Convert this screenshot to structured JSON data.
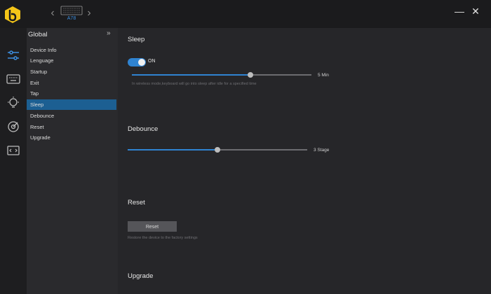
{
  "titlebar": {
    "device_name": "A78",
    "minimize_label": "—",
    "close_label": "✕",
    "back_label": "‹",
    "forward_label": "›"
  },
  "sidebar_icons": [
    {
      "name": "settings-sliders-icon",
      "active": true
    },
    {
      "name": "keyboard-icon",
      "active": false
    },
    {
      "name": "lighting-icon",
      "active": false
    },
    {
      "name": "macro-target-icon",
      "active": false
    },
    {
      "name": "code-icon",
      "active": false
    }
  ],
  "submenu": {
    "title": "Global",
    "collapse_label": "»",
    "items": [
      {
        "label": "Device Info",
        "active": false
      },
      {
        "label": "Lenguage",
        "active": false
      },
      {
        "label": "Startup",
        "active": false
      },
      {
        "label": "Exit",
        "active": false
      },
      {
        "label": "Tap",
        "active": false
      },
      {
        "label": "Sleep",
        "active": true
      },
      {
        "label": "Debounce",
        "active": false
      },
      {
        "label": "Reset",
        "active": false
      },
      {
        "label": "Upgrade",
        "active": false
      }
    ]
  },
  "sleep": {
    "title": "Sleep",
    "toggle_label": "ON",
    "slider_value_label": "5 Min",
    "slider_fraction": 0.66,
    "hint": "In wireless mode,keyboard will go into sleep after idle for a specified time"
  },
  "debounce": {
    "title": "Debounce",
    "slider_value_label": "3 Stage",
    "slider_fraction": 0.5
  },
  "reset": {
    "title": "Reset",
    "button_label": "Reset",
    "hint": "Restore the device to the factory settings"
  },
  "upgrade": {
    "title": "Upgrade"
  },
  "colors": {
    "accent": "#2f83d1",
    "active_menu": "#1c5f92",
    "logo_yellow": "#f5c518"
  }
}
